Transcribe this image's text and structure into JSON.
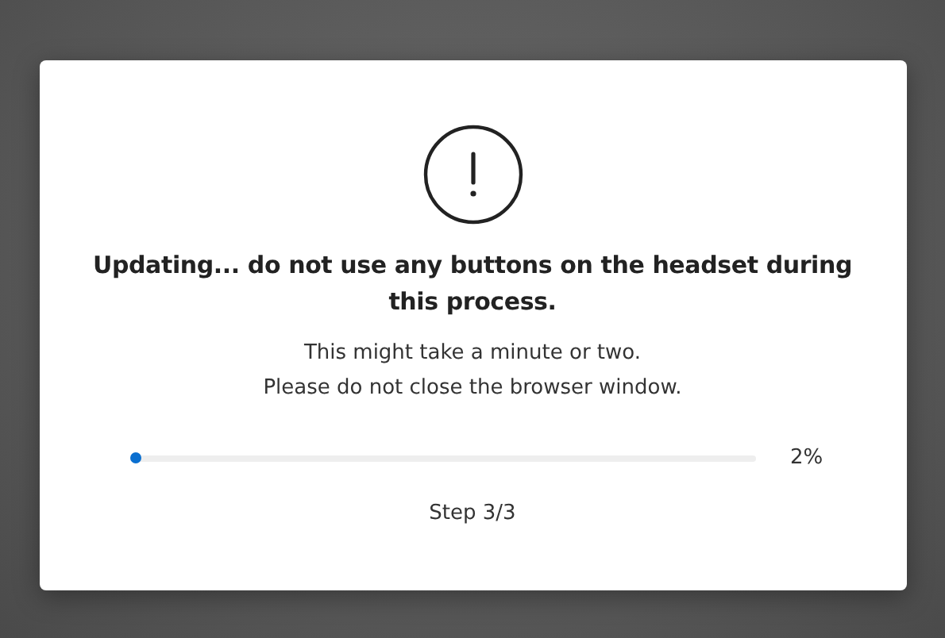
{
  "dialog": {
    "title": "Updating... do not use any buttons on the headset during this process.",
    "messages": [
      "This might take a minute or two.",
      "Please do not close the browser window."
    ],
    "progress": {
      "level": 0.02,
      "reading": "2%"
    },
    "step": "Step 3/3"
  }
}
